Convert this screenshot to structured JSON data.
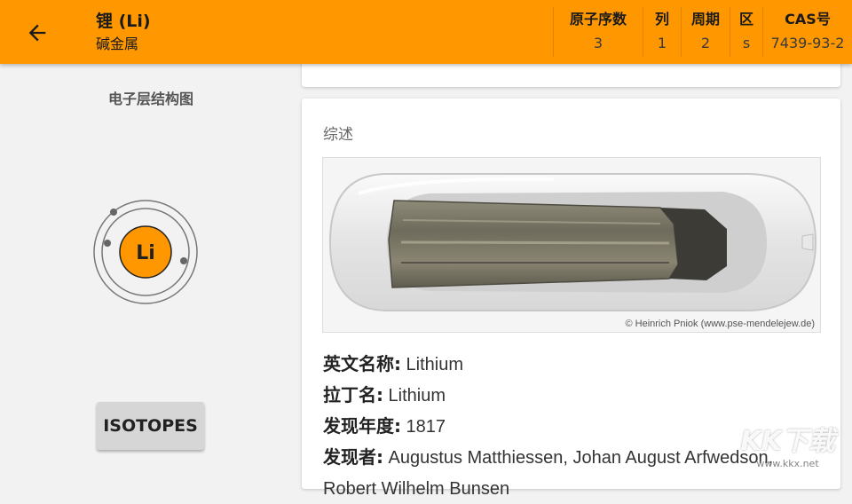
{
  "header": {
    "title": "锂 (Li)",
    "subtitle": "碱金属",
    "props": [
      {
        "label": "原子序数",
        "value": "3"
      },
      {
        "label": "列",
        "value": "1"
      },
      {
        "label": "周期",
        "value": "2"
      },
      {
        "label": "区",
        "value": "s"
      },
      {
        "label": "CAS号",
        "value": "7439-93-2"
      }
    ]
  },
  "left": {
    "shell_title": "电子层结构图",
    "symbol": "Li",
    "isotopes_label": "ISOTOPES"
  },
  "overview": {
    "title": "综述",
    "photo_credit": "© Heinrich Pniok (www.pse-mendelejew.de)",
    "lines": [
      {
        "label": "英文名称:",
        "value": " Lithium"
      },
      {
        "label": "拉丁名:",
        "value": " Lithium"
      },
      {
        "label": "发现年度:",
        "value": " 1817"
      },
      {
        "label": "发现者:",
        "value": " Augustus Matthiessen, Johan August Arfwedson,"
      },
      {
        "label": "",
        "value": "Robert Wilhelm Bunsen"
      }
    ]
  },
  "watermark": {
    "big": "KK下载",
    "small": "www.kkx.net"
  },
  "colors": {
    "accent": "#ff9800",
    "nucleus": "#ff9800"
  }
}
